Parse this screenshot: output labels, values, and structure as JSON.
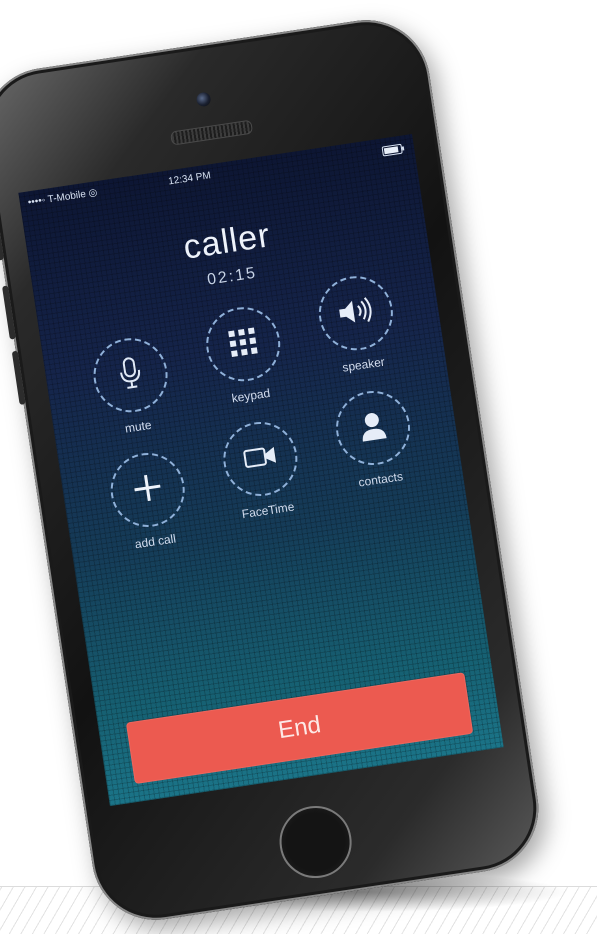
{
  "status_bar": {
    "carrier": "••••◦ T-Mobile ◎",
    "time": "12:34 PM",
    "battery_level": 0.85
  },
  "call": {
    "caller_name": "caller",
    "timer": "02:15"
  },
  "buttons": {
    "mute": "mute",
    "keypad": "keypad",
    "speaker": "speaker",
    "add_call": "add call",
    "facetime": "FaceTime",
    "contacts": "contacts"
  },
  "end_button": "End",
  "colors": {
    "end_button": "#ec5a50",
    "screen_top": "#0d1633",
    "screen_bottom": "#1b7488",
    "ring": "#8fb0d8"
  },
  "icons": [
    "microphone-icon",
    "keypad-icon",
    "speaker-icon",
    "plus-icon",
    "video-camera-icon",
    "person-icon"
  ]
}
